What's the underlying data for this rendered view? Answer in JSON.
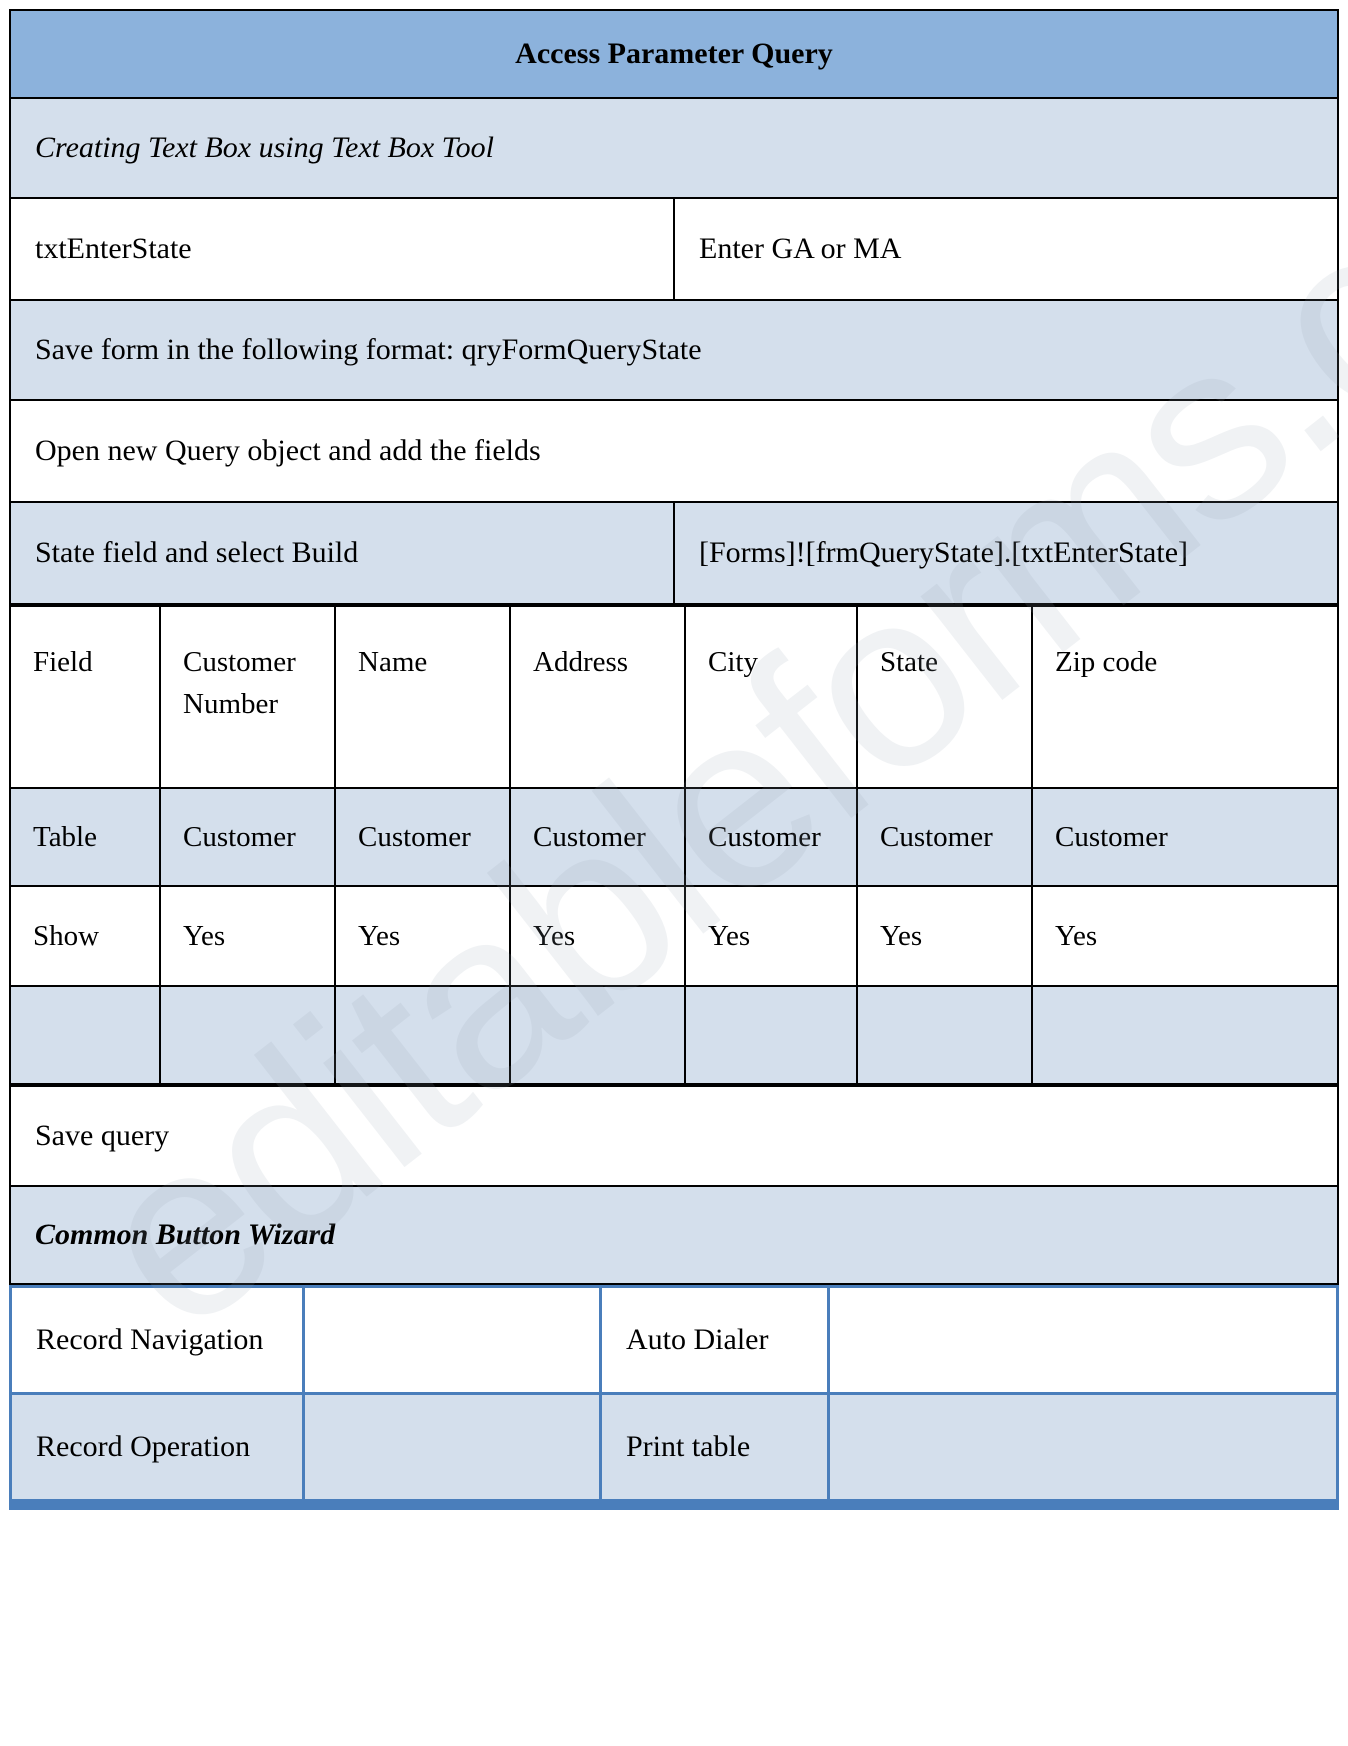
{
  "document": {
    "title": "Access Parameter Query",
    "watermark": "editableforms.com"
  },
  "sections": {
    "subtitle": "Creating Text Box using Text Box Tool",
    "textbox_row": {
      "name": "txtEnterState",
      "caption": "Enter GA or MA"
    },
    "save_form": "Save form in the following format: qryFormQueryState",
    "open_query": "Open new Query object and add the fields",
    "state_build": {
      "label": "State field and select Build",
      "expression": "[Forms]![frmQueryState].[txtEnterState]"
    },
    "save_query": "Save query",
    "wizard_title": "Common Button Wizard"
  },
  "query_grid": {
    "rows": [
      {
        "key": "field",
        "cells": [
          "Field",
          "Customer Number",
          "Name",
          "Address",
          "City",
          "State",
          "Zip code"
        ]
      },
      {
        "key": "table",
        "cells": [
          "Table",
          "Customer",
          "Customer",
          "Customer",
          "Customer",
          "Customer",
          "Customer"
        ]
      },
      {
        "key": "show",
        "cells": [
          "Show",
          "Yes",
          "Yes",
          "Yes",
          "Yes",
          "Yes",
          "Yes"
        ]
      },
      {
        "key": "blank",
        "cells": [
          "",
          "",
          "",
          "",
          "",
          "",
          ""
        ]
      }
    ]
  },
  "wizard_table": {
    "rows": [
      {
        "cells": [
          "Record Navigation",
          "",
          "Auto Dialer",
          ""
        ]
      },
      {
        "cells": [
          "Record Operation",
          "",
          "Print table",
          ""
        ]
      }
    ]
  },
  "colors": {
    "header_blue": "#8cb2dc",
    "light_blue": "#d4dfec",
    "border_black": "#000000",
    "border_blue": "#4a7ebb",
    "white": "#ffffff"
  }
}
